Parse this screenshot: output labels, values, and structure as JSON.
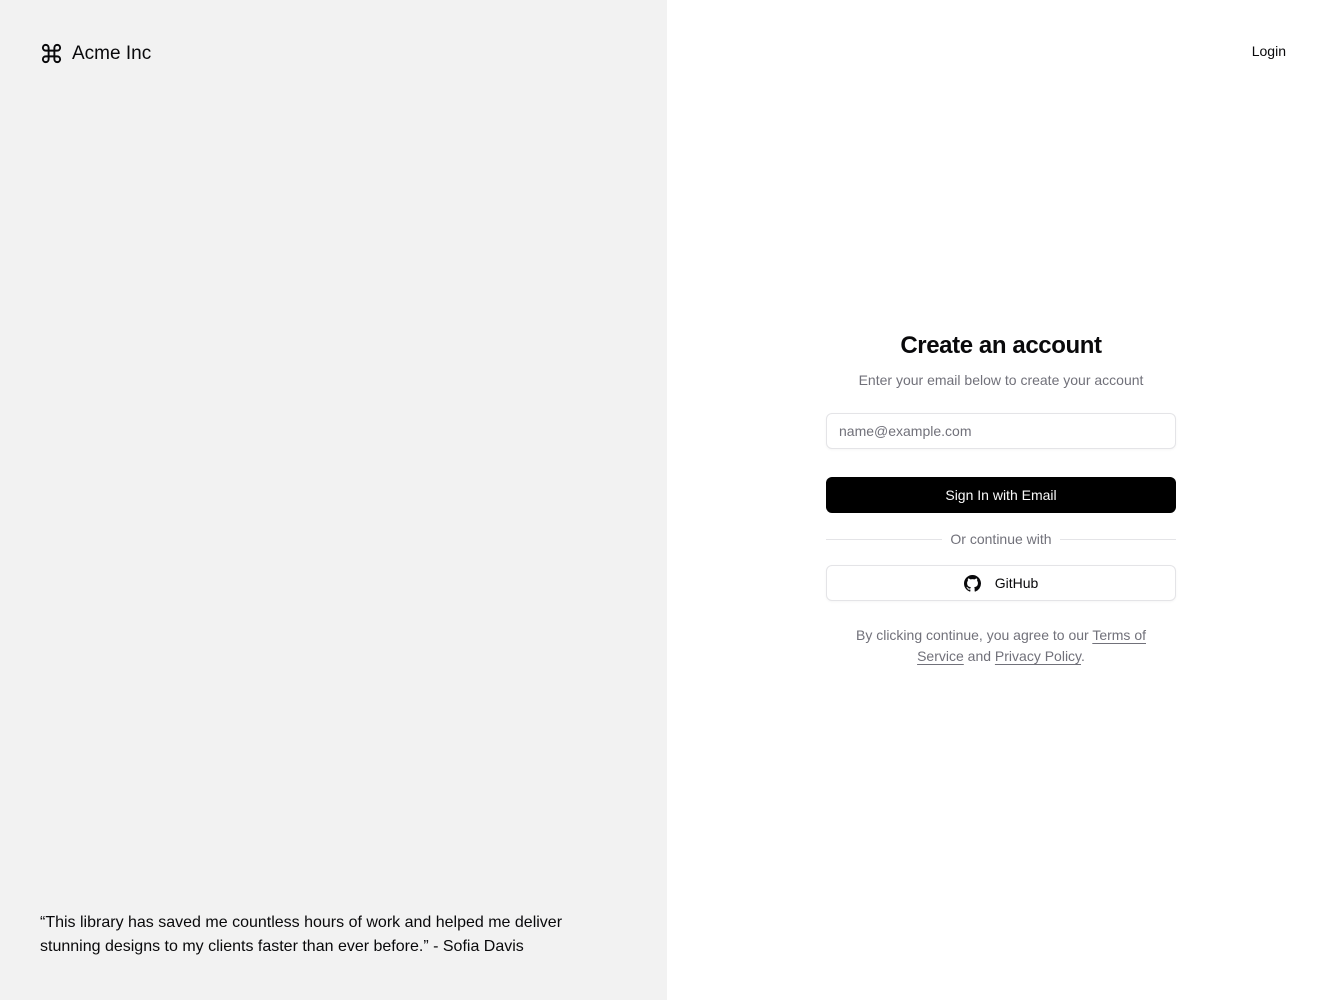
{
  "brand": {
    "name": "Acme Inc",
    "icon": "command-icon"
  },
  "testimonial": {
    "text": "“This library has saved me countless hours of work and helped me deliver stunning designs to my clients faster than ever before.” - Sofia Davis"
  },
  "nav": {
    "login_label": "Login"
  },
  "form": {
    "title": "Create an account",
    "subtitle": "Enter your email below to create your account",
    "email_placeholder": "name@example.com",
    "email_value": "",
    "submit_label": "Sign In with Email",
    "divider_label": "Or continue with",
    "github_label": "GitHub",
    "github_icon": "github-icon"
  },
  "legal": {
    "prefix": "By clicking continue, you agree to our ",
    "terms_label": "Terms of Service",
    "middle": " and ",
    "privacy_label": "Privacy Policy",
    "suffix": "."
  },
  "colors": {
    "left_panel_bg": "#f2f2f2",
    "primary_button_bg": "#000000",
    "muted_text": "#71717a",
    "border": "#e4e4e7"
  }
}
